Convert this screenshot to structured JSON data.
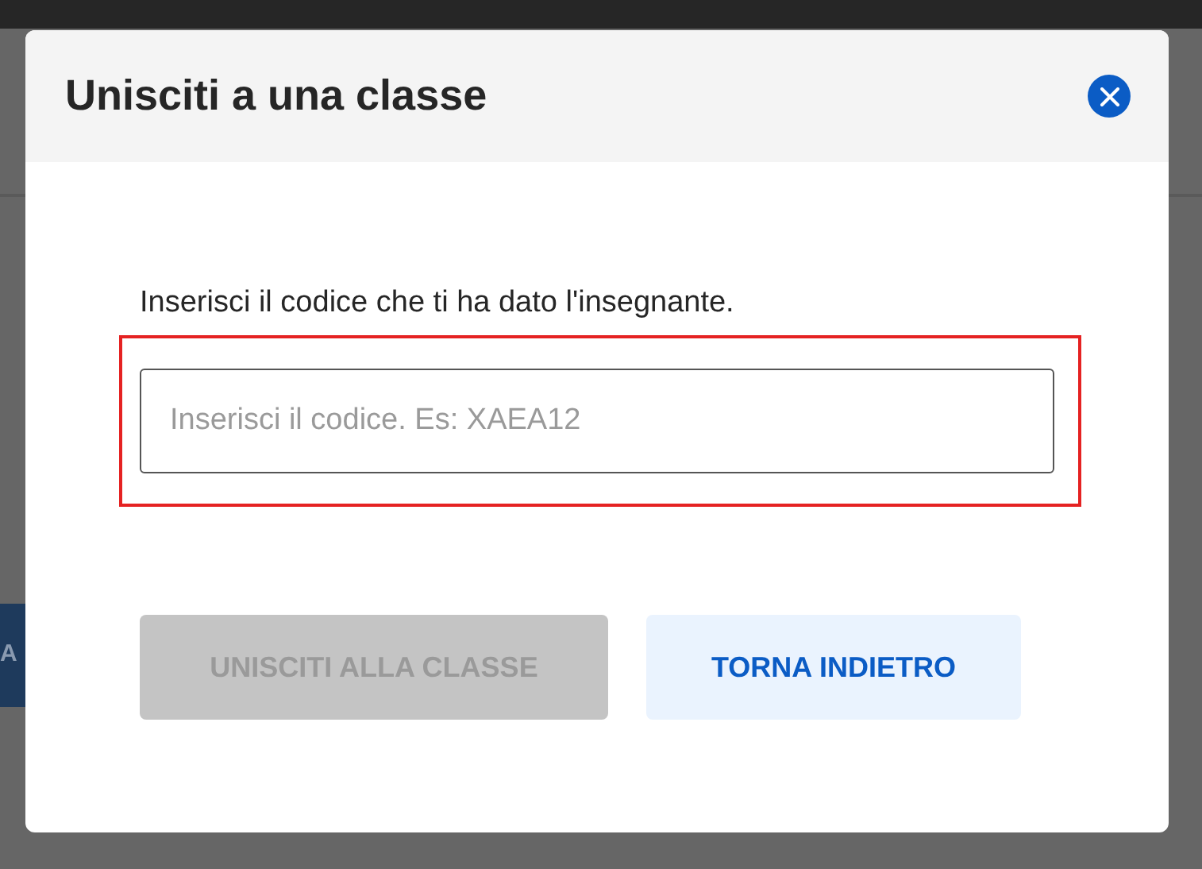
{
  "background": {
    "button_fragment": "A"
  },
  "dialog": {
    "title": "Unisciti a una classe",
    "prompt": "Inserisci il codice che ti ha dato l'insegnante.",
    "code_field": {
      "placeholder": "Inserisci il codice. Es: XAEA12",
      "highlighted": true
    },
    "buttons": [
      {
        "label": "UNISCITI ALLA CLASSE",
        "kind": "primary",
        "disabled": true
      },
      {
        "label": "TORNA INDIETRO",
        "kind": "secondary",
        "disabled": false
      }
    ]
  }
}
